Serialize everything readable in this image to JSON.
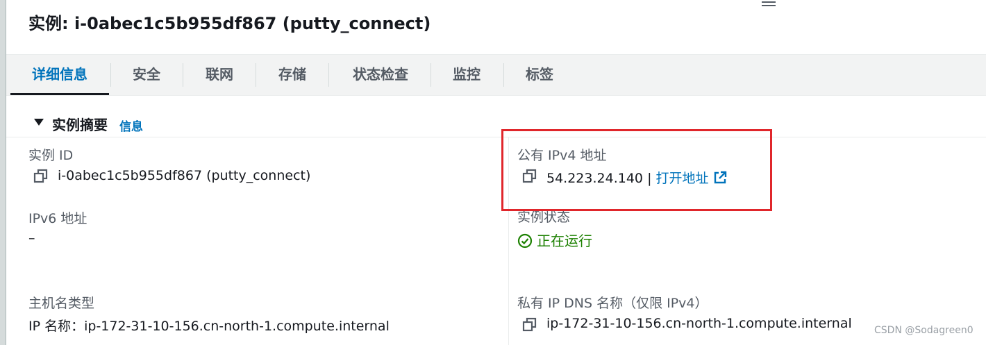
{
  "header": {
    "title": "实例: i-0abec1c5b955df867 (putty_connect)"
  },
  "tabs": [
    {
      "label": "详细信息",
      "active": true
    },
    {
      "label": "安全"
    },
    {
      "label": "联网"
    },
    {
      "label": "存储"
    },
    {
      "label": "状态检查"
    },
    {
      "label": "监控"
    },
    {
      "label": "标签"
    }
  ],
  "summary": {
    "title": "实例摘要",
    "info_link": "信息"
  },
  "fields": {
    "instance_id": {
      "label": "实例 ID",
      "value": "i-0abec1c5b955df867 (putty_connect)"
    },
    "public_ipv4": {
      "label": "公有 IPv4 地址",
      "value": "54.223.24.140",
      "separator": "|",
      "open_link": "打开地址"
    },
    "ipv6": {
      "label": "IPv6 地址",
      "value": "–"
    },
    "instance_state": {
      "label": "实例状态",
      "value": "正在运行"
    },
    "hostname_type": {
      "label": "主机名类型",
      "value": "IP 名称：ip-172-31-10-156.cn-north-1.compute.internal"
    },
    "private_dns": {
      "label": "私有 IP DNS 名称（仅限 IPv4）",
      "value": "ip-172-31-10-156.cn-north-1.compute.internal"
    }
  },
  "icons": {
    "copy": "copy-icon",
    "external_link": "external-link-icon",
    "status_ok": "check-circle-icon",
    "menu": "menu-icon",
    "caret": "caret-down-icon"
  },
  "colors": {
    "link": "#0073bb",
    "status_running": "#1d8102",
    "highlight_box": "#e0262b"
  },
  "watermark": "CSDN @Sodagreen0"
}
